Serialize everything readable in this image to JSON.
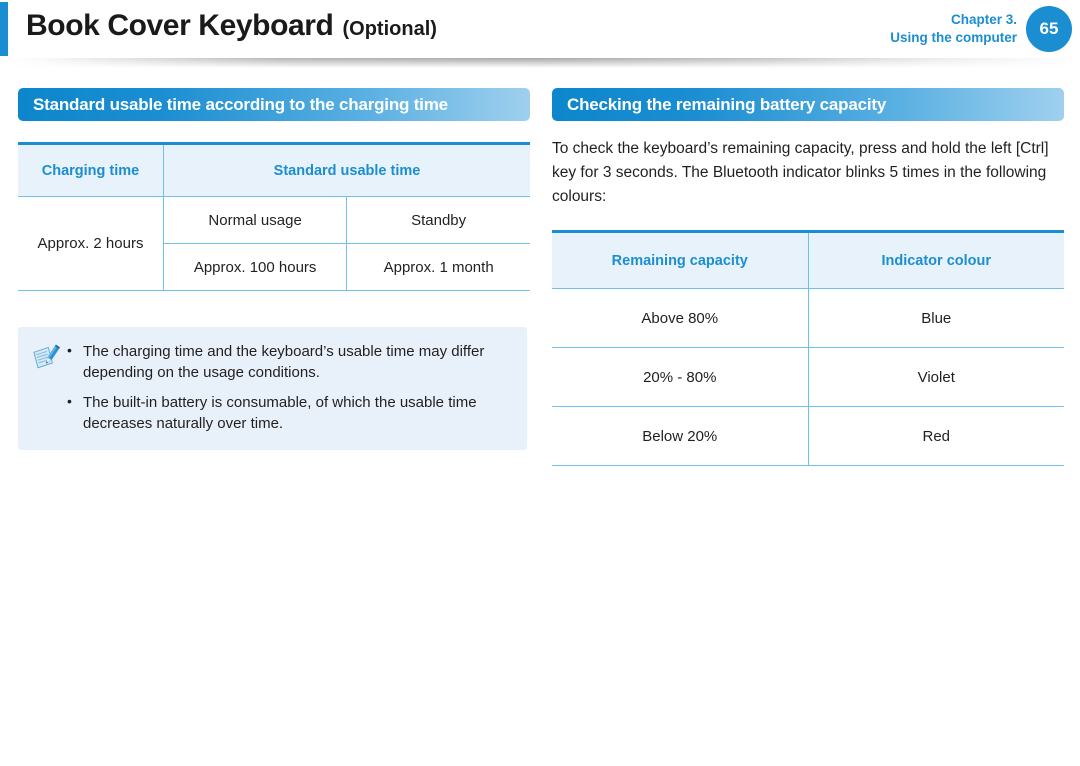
{
  "header": {
    "title": "Book Cover Keyboard",
    "title_suffix": "(Optional)",
    "chapter_line1": "Chapter 3.",
    "chapter_line2": "Using the computer",
    "page_number": "65",
    "accent_color": "#1b8ed2"
  },
  "left_column": {
    "section_title": "Standard usable time according to the charging time",
    "table": {
      "headers": [
        "Charging time",
        "Standard usable time"
      ],
      "charging_time_value": "Approx. 2 hours",
      "rows": [
        [
          "Normal usage",
          "Standby"
        ],
        [
          "Approx. 100 hours",
          "Approx. 1 month"
        ]
      ]
    },
    "note": {
      "icon": "note-pencil-icon",
      "items": [
        "The charging time and the keyboard’s usable time may differ depending on the usage conditions.",
        "The built-in battery is consumable, of which the usable time decreases naturally over time."
      ]
    }
  },
  "right_column": {
    "section_title": "Checking the remaining battery capacity",
    "paragraph": "To check the keyboard’s remaining capacity, press and hold the left [Ctrl] key for 3 seconds. The Bluetooth indicator blinks 5 times in the following colours:",
    "table": {
      "headers": [
        "Remaining capacity",
        "Indicator colour"
      ],
      "rows": [
        [
          "Above 80%",
          "Blue"
        ],
        [
          "20% - 80%",
          "Violet"
        ],
        [
          "Below 20%",
          "Red"
        ]
      ]
    }
  }
}
